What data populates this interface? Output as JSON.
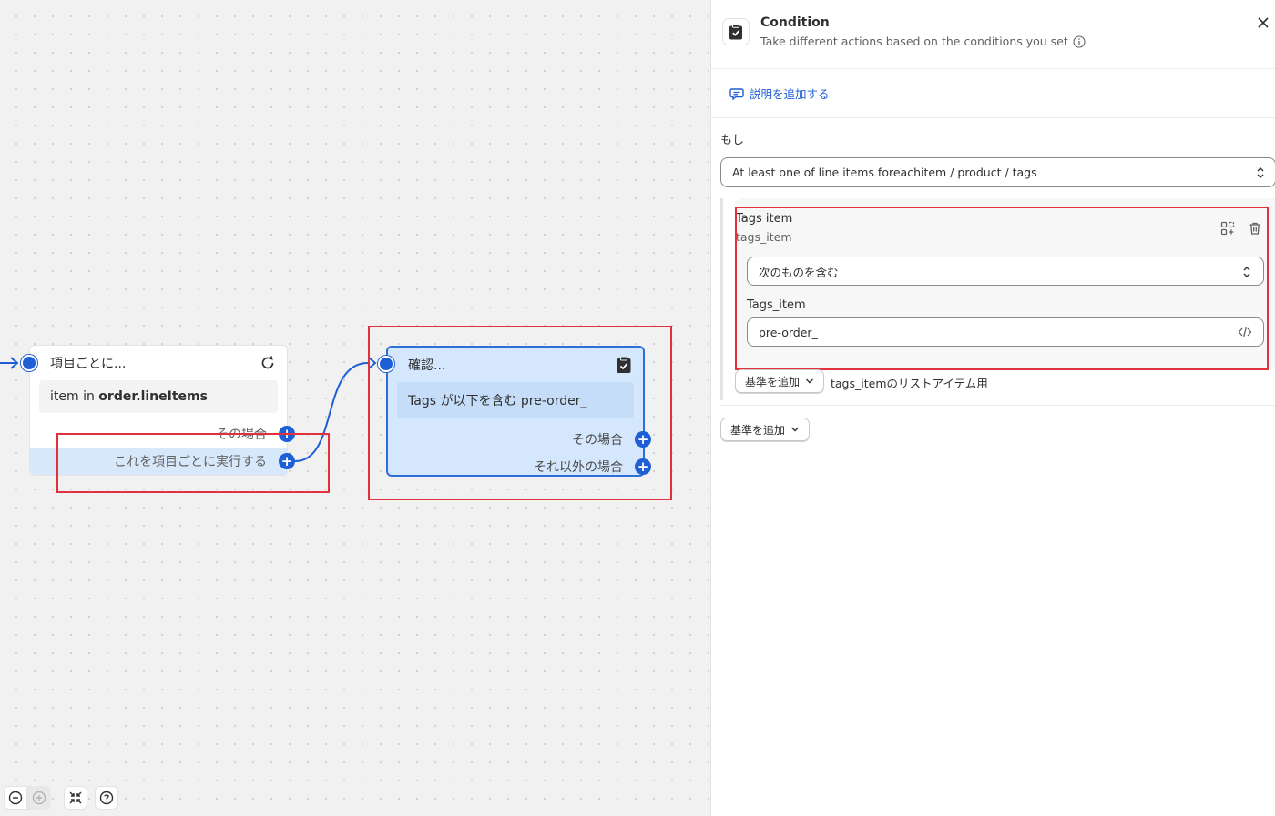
{
  "canvas": {
    "foreach_node": {
      "title": "項目ごとに...",
      "body_prefix": "item in ",
      "body_strong": "order.lineItems",
      "branch_then": "その場合",
      "branch_each": "これを項目ごとに実行する"
    },
    "condition_node": {
      "title": "確認...",
      "body": "Tags が以下を含む pre-order_",
      "branch_then": "その場合",
      "branch_else": "それ以外の場合"
    }
  },
  "panel": {
    "title": "Condition",
    "subtitle": "Take different actions based on the conditions you set",
    "add_description": "説明を追加する",
    "if_label": "もし",
    "main_select": "At least one of line items foreachitem / product / tags",
    "criterion": {
      "title": "Tags item",
      "subtitle": "tags_item",
      "operator": "次のものを含む",
      "value_label": "Tags_item",
      "value": "pre-order_"
    },
    "add_criteria_inner": "基準を追加",
    "add_criteria_note": "tags_itemのリストアイテム用",
    "add_criteria_outer": "基準を追加"
  },
  "colors": {
    "accent": "#1f5fd6",
    "highlight": "#e0313c",
    "node_selected_bg": "#d4e7fc"
  }
}
